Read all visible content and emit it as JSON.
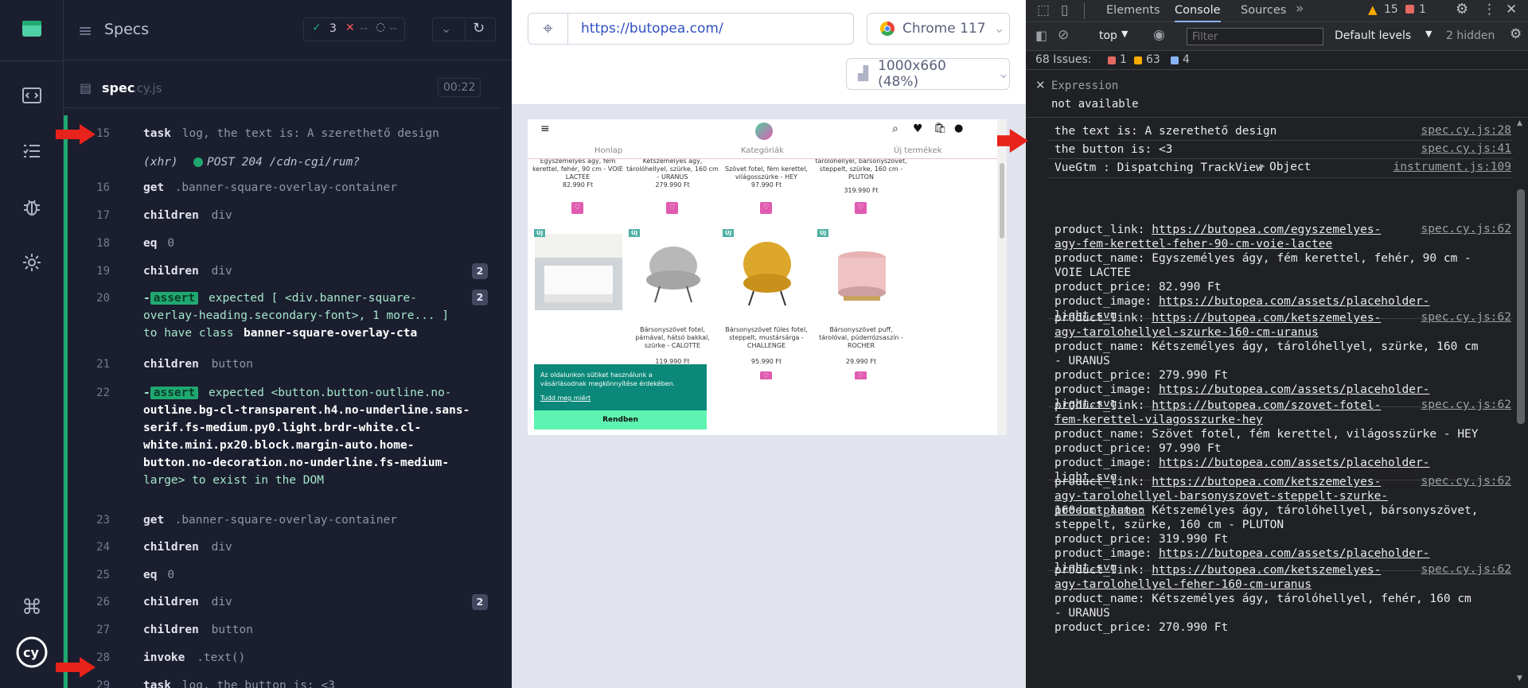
{
  "reporter": {
    "title": "Specs",
    "passed": "3",
    "failed": "--",
    "pending": "--",
    "spec_name": "spec",
    "spec_ext": ".cy.js",
    "duration": "00:22",
    "commands": [
      {
        "num": "15",
        "name": "task",
        "arg": "log, the text is: A szerethető design"
      },
      {
        "num": "",
        "name": "(xhr)",
        "arg": "POST 204 /cdn-cgi/rum?"
      },
      {
        "num": "16",
        "name": "get",
        "arg": ".banner-square-overlay-container"
      },
      {
        "num": "17",
        "name": "children",
        "arg": "div"
      },
      {
        "num": "18",
        "name": "eq",
        "arg": "0"
      },
      {
        "num": "19",
        "name": "children",
        "arg": "div",
        "badge": "2"
      },
      {
        "num": "20",
        "name": "-assert",
        "l1": "expected [ <div.banner-square-",
        "l2": "overlay-heading.secondary-font>, 1 more... ]",
        "l3a": "to have class ",
        "l3b": "banner-square-overlay-cta",
        "badge": "2"
      },
      {
        "num": "21",
        "name": "children",
        "arg": "button"
      },
      {
        "num": "22",
        "name": "-assert",
        "lines": [
          "expected <button.button-outline.no-",
          "outline.bg-cl-transparent.h4.no-underline.sans-",
          "serif.fs-medium.py0.light.brdr-white.cl-",
          "white.mini.px20.block.margin-auto.home-",
          "button.no-decoration.no-underline.fs-medium-",
          "large> to exist in the DOM"
        ]
      },
      {
        "num": "23",
        "name": "get",
        "arg": ".banner-square-overlay-container"
      },
      {
        "num": "24",
        "name": "children",
        "arg": "div"
      },
      {
        "num": "25",
        "name": "eq",
        "arg": "0"
      },
      {
        "num": "26",
        "name": "children",
        "arg": "div",
        "badge": "2"
      },
      {
        "num": "27",
        "name": "children",
        "arg": "button"
      },
      {
        "num": "28",
        "name": "invoke",
        "arg": ".text()"
      },
      {
        "num": "29",
        "name": "task",
        "arg": "log, the button is: <3"
      }
    ]
  },
  "aut": {
    "url": "https://butopea.com/",
    "browser": "Chrome 117",
    "viewport": "1000x660 (48%)",
    "site": {
      "nav": [
        "Honlap",
        "Kategóriák",
        "Új termékek"
      ],
      "top_products": [
        {
          "name": "Egyszemélyes ágy, fém kerettel, fehér, 90 cm - VOIE LACTEE",
          "price": "82.990 Ft"
        },
        {
          "name": "Kétszemélyes ágy, tárolóhellyel, szürke, 160 cm - URANUS",
          "price": "279.990 Ft"
        },
        {
          "name": "Szövet fotel, fém kerettel, világosszürke - HEY",
          "price": "97.990 Ft"
        },
        {
          "name": "Kétszemélyes ágy, tárolóhellyel, bársonyszövet, steppelt, szürke, 160 cm - PLUTON",
          "price": "319.990 Ft"
        }
      ],
      "badge": "ÚJ",
      "bottom_products": [
        {
          "name": "",
          "price": ""
        },
        {
          "name": "Bársonyszövet fotel, párnával, hátsó bakkal, szürke - CALOTTE",
          "price": "119.990 Ft"
        },
        {
          "name": "Bársonyszövet füles fotel, steppelt, mustársárga - CHALLENGE",
          "price": "95.990 Ft"
        },
        {
          "name": "Bársonyszövet puff, tárolóval, púderrózsaszín - ROCHER",
          "price": "29.990 Ft"
        }
      ],
      "cookie": {
        "text": "Az oldalunkon sütiket használunk a vásárlásodnak megkönnyítése érdekében.",
        "link": "Tudd meg miért",
        "button": "Rendben"
      }
    }
  },
  "devtools": {
    "tabs": [
      "Elements",
      "Console",
      "Sources"
    ],
    "warn_count": "15",
    "err_count": "1",
    "context": "top",
    "filter_placeholder": "Filter",
    "levels": "Default levels",
    "hidden": "2 hidden",
    "issues_label": "68 Issues:",
    "issues_err": "1",
    "issues_warn": "63",
    "issues_info": "4",
    "expression_label": "Expression",
    "expression_value": "not available",
    "logs": [
      {
        "text": "the text is: A szerethető design",
        "src": "spec.cy.js:28"
      },
      {
        "text": "the button is: <3",
        "src": "spec.cy.js:41"
      },
      {
        "text": "VueGtm : Dispatching TrackView ",
        "obj": "Object",
        "src": "instrument.js:109"
      }
    ],
    "products": [
      {
        "link": "https://butopea.com/egyszemelyes-agy-fem-kerettel-feher-90-cm-voie-lactee",
        "name": "Egyszemélyes ágy, fém kerettel, fehér, 90 cm - VOIE LACTEE",
        "price": "82.990 Ft",
        "image": "https://butopea.com/assets/placeholder-light.svg",
        "src": "spec.cy.js:62"
      },
      {
        "link": "https://butopea.com/ketszemelyes-agy-tarolohellyel-szurke-160-cm-uranus",
        "name": "Kétszemélyes ágy, tárolóhellyel, szürke, 160 cm - URANUS",
        "price": "279.990 Ft",
        "image": "https://butopea.com/assets/placeholder-light.svg",
        "src": "spec.cy.js:62"
      },
      {
        "link": "https://butopea.com/szovet-fotel-fem-kerettel-vilagosszurke-hey",
        "name": "Szövet fotel, fém kerettel, világosszürke - HEY",
        "price": "97.990 Ft",
        "image": "https://butopea.com/assets/placeholder-light.svg",
        "src": "spec.cy.js:62"
      },
      {
        "link": "https://butopea.com/ketszemelyes-agy-tarolohellyel-barsonyszovet-steppelt-szurke-160-cm-pluton",
        "name": "Kétszemélyes ágy, tárolóhellyel, bársonyszövet, steppelt, szürke, 160 cm - PLUTON",
        "price": "319.990 Ft",
        "image": "https://butopea.com/assets/placeholder-light.svg",
        "src": "spec.cy.js:62"
      },
      {
        "link": "https://butopea.com/ketszemelyes-agy-tarolohellyel-feher-160-cm-uranus",
        "name": "Kétszemélyes ágy, tárolóhellyel, fehér, 160 cm - URANUS",
        "price": "270.990 Ft",
        "image": "",
        "src": "spec.cy.js:62"
      }
    ],
    "labels": {
      "link": "product_link: ",
      "name": "product_name: ",
      "price": "product_price: ",
      "image": "product_image: "
    }
  }
}
